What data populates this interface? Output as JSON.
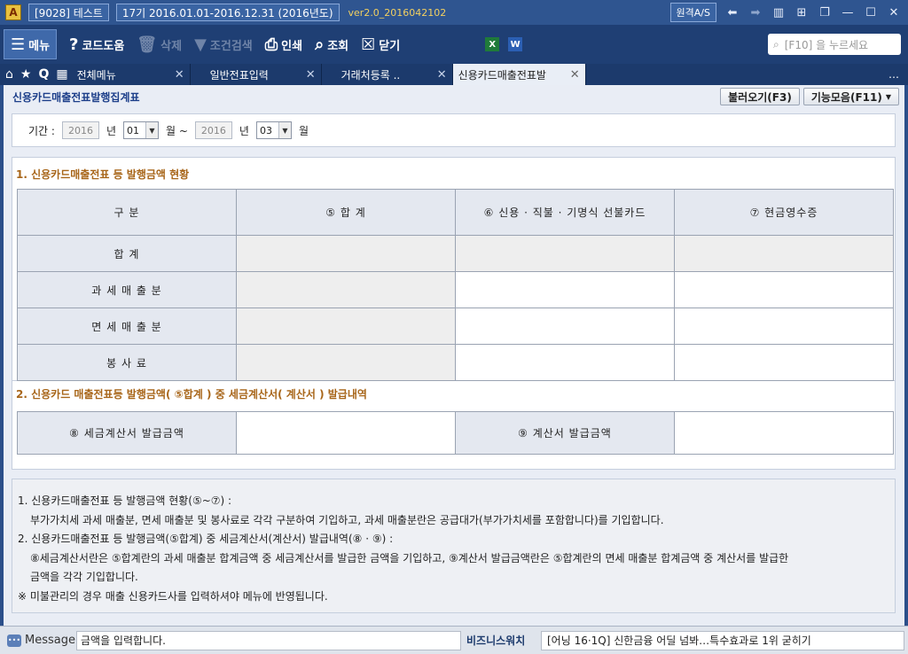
{
  "titlebar": {
    "logo": "A",
    "company": "[9028] 테스트",
    "period": "17기  2016.01.01-2016.12.31  (2016년도)",
    "version": "ver2.0_2016042102",
    "remote_as": "원격A/S"
  },
  "toolbar": {
    "menu": "메뉴",
    "help": "코드도움",
    "delete": "삭제",
    "condition_search": "조건검색",
    "print": "인쇄",
    "query": "조회",
    "close": "닫기",
    "search_placeholder": "[F10] 을 누르세요"
  },
  "tabs": [
    {
      "label": "전체메뉴"
    },
    {
      "label": "일반전표입력"
    },
    {
      "label": "거래처등록 .."
    },
    {
      "label": "신용카드매출전표발"
    }
  ],
  "page": {
    "title": "신용카드매출전표발행집계표",
    "load_button": "불러오기(F3)",
    "functions_button": "기능모음(F11)"
  },
  "period": {
    "label": "기간 :",
    "from_year": "2016",
    "year_unit": "년",
    "from_month": "01",
    "month_unit_tilde": "월 ~",
    "to_year": "2016",
    "to_month": "03",
    "month_unit": "월"
  },
  "section1": {
    "title": "1. 신용카드매출전표 등 발행금액 현황",
    "headers": [
      "구        분",
      "⑤ 합          계",
      "⑥ 신용 · 직불 · 기명식 선불카드",
      "⑦ 현금영수증"
    ],
    "rows": [
      {
        "label": "합          계"
      },
      {
        "label": "과 세 매 출 분"
      },
      {
        "label": "면 세 매 출 분"
      },
      {
        "label": "봉     사     료"
      }
    ]
  },
  "section2": {
    "title": "2. 신용카드 매출전표등 발행금액( ⑤합계 ) 중 세금계산서( 계산서 ) 발급내역",
    "tax_invoice_label": "⑧ 세금계산서  발급금액",
    "invoice_label": "⑨ 계산서  발급금액"
  },
  "notes": {
    "line1": "1. 신용카드매출전표 등 발행금액 현황(⑤~⑦) :",
    "line2": "부가가치세 과세 매출분, 면세 매출분 및 봉사료로 각각 구분하여 기입하고, 과세 매출분란은 공급대가(부가가치세를 포함합니다)를 기입합니다.",
    "line3": "2. 신용카드매출전표 등 발행금액(⑤합계) 중 세금계산서(계산서) 발급내역(⑧ · ⑨) :",
    "line4": "⑧세금계산서란은 ⑤합계란의 과세 매출분 합계금액 중 세금계산서를 발급한 금액을 기입하고, ⑨계산서  발급금액란은 ⑤합계란의 면세 매출분 합계금액 중 계산서를 발급한",
    "line5": "금액을 각각 기입합니다.",
    "line6": "※ 미불관리의 경우 매출 신용카드사를 입력하셔야 메뉴에 반영됩니다."
  },
  "status": {
    "message_label": "Message",
    "message": "금액을 입력합니다.",
    "biz_watch": "비즈니스워치",
    "news": "[어닝 16·1Q] 신한금융 어딜 넘봐…특수효과로 1위 굳히기"
  }
}
